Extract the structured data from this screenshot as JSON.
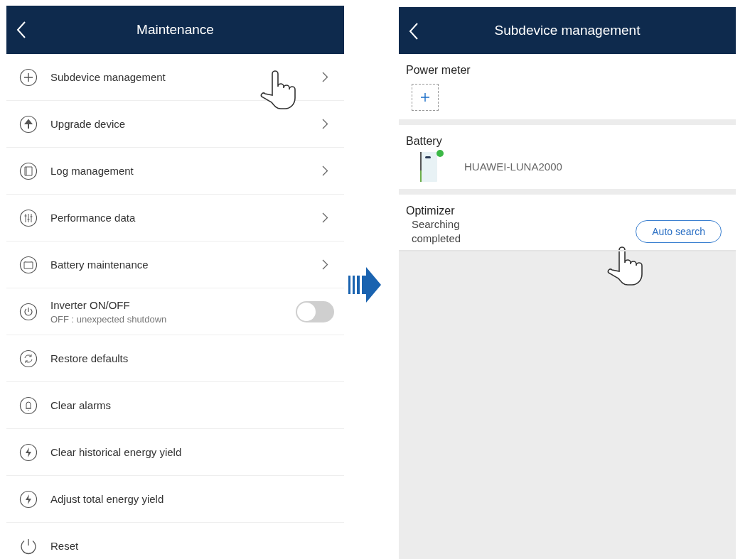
{
  "left_screen": {
    "title": "Maintenance",
    "items": [
      {
        "kind": "link",
        "label": "Subdevice management"
      },
      {
        "kind": "link",
        "label": "Upgrade device"
      },
      {
        "kind": "link",
        "label": "Log management"
      },
      {
        "kind": "link",
        "label": "Performance data"
      },
      {
        "kind": "link",
        "label": "Battery maintenance"
      },
      {
        "kind": "toggle",
        "label": "Inverter ON/OFF",
        "sublabel": "OFF : unexpected shutdown",
        "on": false
      },
      {
        "kind": "action",
        "label": "Restore defaults"
      },
      {
        "kind": "action",
        "label": "Clear alarms"
      },
      {
        "kind": "action",
        "label": "Clear historical energy yield"
      },
      {
        "kind": "action",
        "label": "Adjust total energy yield"
      },
      {
        "kind": "action",
        "label": "Reset"
      }
    ]
  },
  "right_screen": {
    "title": "Subdevice management",
    "power_meter": {
      "heading": "Power meter"
    },
    "battery": {
      "heading": "Battery",
      "device": "HUAWEI-LUNA2000",
      "online": true
    },
    "optimizer": {
      "heading": "Optimizer",
      "status": "Searching completed",
      "button": "Auto search"
    }
  }
}
